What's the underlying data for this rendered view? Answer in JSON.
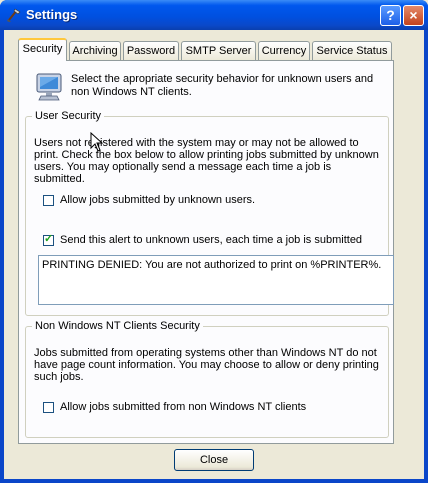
{
  "window": {
    "title": "Settings",
    "help_glyph": "?",
    "close_glyph": "×"
  },
  "tabs": [
    {
      "label": "Security",
      "active": true
    },
    {
      "label": "Archiving",
      "active": false
    },
    {
      "label": "Password",
      "active": false
    },
    {
      "label": "SMTP Server",
      "active": false
    },
    {
      "label": "Currency",
      "active": false
    },
    {
      "label": "Service Status",
      "active": false
    }
  ],
  "intro": "Select the apropriate security behavior for unknown users and non Windows NT clients.",
  "user_security": {
    "title": "User Security",
    "description": "Users not registered with the system may or may not be allowed to print. Check the box below to allow printing jobs submitted by unknown users. You may optionally send a message each time a job is submitted.",
    "allow_label": "Allow jobs submitted by unknown users.",
    "allow_checked": false,
    "alert_label": "Send this alert to unknown users, each time a job is submitted",
    "alert_checked": true,
    "message": "PRINTING DENIED: You are not authorized to print on %PRINTER%."
  },
  "non_nt": {
    "title": "Non Windows NT Clients Security",
    "description": "Jobs submitted from operating systems other than Windows NT do not have page count information. You may choose to allow or deny printing such jobs.",
    "allow_label": "Allow jobs submitted from non Windows NT clients",
    "allow_checked": false
  },
  "footer": {
    "close_label": "Close"
  },
  "icons": {
    "app": "settings-app-icon",
    "security": "computer-monitor-icon",
    "check": "checkmark-icon"
  }
}
